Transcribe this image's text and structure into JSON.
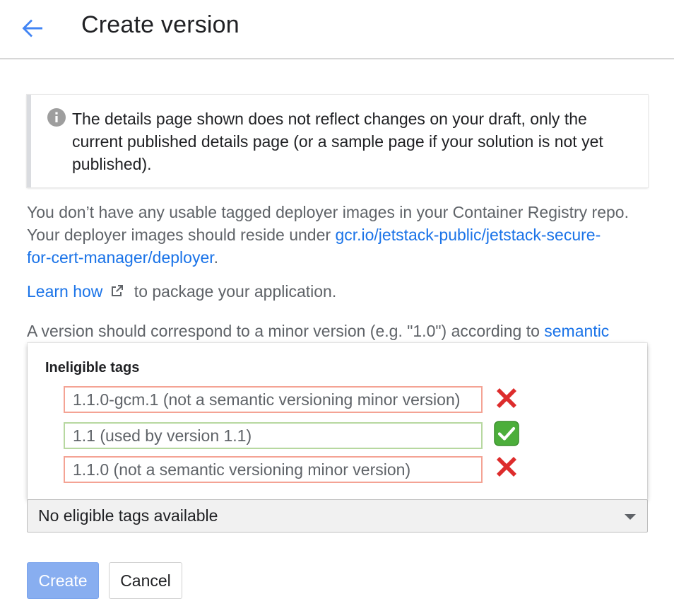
{
  "header": {
    "back_icon": "arrow-back-icon",
    "title": "Create version"
  },
  "info_box": {
    "icon": "info-icon",
    "text": "The details page shown does not reflect changes on your draft, only the current published details page (or a sample page if your solution is not yet published)."
  },
  "registry_notice": {
    "line1": "You don’t have any usable tagged deployer images in your Container Registry repo.",
    "line2_prefix": "Your deployer images should reside under ",
    "path_link_part1": "gcr.io/jetstack-public/jetstack-secure-",
    "path_link_part2": "for-cert-manager/deployer",
    "line3_suffix": "."
  },
  "learn": {
    "link": "Learn how",
    "external_icon": "external-link-icon",
    "suffix": " to package your application."
  },
  "version_hint": {
    "prefix": "A version should correspond to a minor version (e.g. \"1.0\") according to ",
    "link": "semantic"
  },
  "ineligible_popup": {
    "title": "Ineligible tags",
    "tags": [
      {
        "label": "1.1.0-gcm.1 (not a semantic versioning minor version)",
        "status": "invalid",
        "icon": "red-x-icon"
      },
      {
        "label": "1.1 (used by version 1.1)",
        "status": "valid",
        "icon": "green-check-icon"
      },
      {
        "label": "1.1.0 (not a semantic versioning minor version)",
        "status": "invalid",
        "icon": "red-x-icon"
      }
    ]
  },
  "tag_select": {
    "value": "No eligible tags available",
    "icon": "dropdown-caret-icon"
  },
  "actions": {
    "create_label": "Create",
    "cancel_label": "Cancel"
  },
  "colors": {
    "link": "#1a73e8",
    "invalid_border": "#f4a394",
    "valid_border": "#b7d8a0",
    "create_button": "#88aef0"
  }
}
